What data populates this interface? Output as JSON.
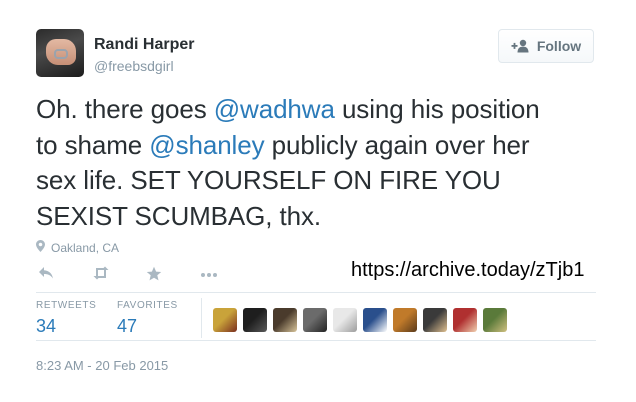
{
  "author": {
    "name": "Randi Harper",
    "handle": "@freebsdgirl"
  },
  "follow_button": {
    "label": "Follow"
  },
  "tweet": {
    "lines": [
      [
        {
          "text": "Oh. there goes ",
          "type": "text"
        },
        {
          "text": "@wadhwa",
          "type": "mention"
        },
        {
          "text": " using his position",
          "type": "text"
        }
      ],
      [
        {
          "text": "to shame ",
          "type": "text"
        },
        {
          "text": "@shanley",
          "type": "mention"
        },
        {
          "text": " publicly again over her",
          "type": "text"
        }
      ],
      [
        {
          "text": "sex life. SET YOURSELF ON FIRE YOU",
          "type": "text"
        }
      ],
      [
        {
          "text": "SEXIST SCUMBAG, thx.",
          "type": "text"
        }
      ]
    ]
  },
  "location": "Oakland, CA",
  "actions": [
    {
      "name": "reply-icon"
    },
    {
      "name": "retweet-icon"
    },
    {
      "name": "favorite-star-icon"
    },
    {
      "name": "more-options-icon"
    }
  ],
  "archive_link": "https://archive.today/zTjb1",
  "stats": {
    "retweets_label": "RETWEETS",
    "retweets_count": "34",
    "favorites_label": "FAVORITES",
    "favorites_count": "47"
  },
  "favoriter_avatars": [
    {
      "name": "favoriter-avatar-1",
      "colors": [
        "#c9a33a",
        "#7a2e1e"
      ]
    },
    {
      "name": "favoriter-avatar-2",
      "colors": [
        "#1e1e1e",
        "#5a5a5a"
      ]
    },
    {
      "name": "favoriter-avatar-3",
      "colors": [
        "#4a3b2c",
        "#d8c49a"
      ]
    },
    {
      "name": "favoriter-avatar-4",
      "colors": [
        "#6b6b6b",
        "#222222"
      ]
    },
    {
      "name": "favoriter-avatar-5",
      "colors": [
        "#e8e8e8",
        "#9c9c9c"
      ]
    },
    {
      "name": "favoriter-avatar-6",
      "colors": [
        "#2a4f8c",
        "#ffffff"
      ]
    },
    {
      "name": "favoriter-avatar-7",
      "colors": [
        "#c07a2a",
        "#5a3a1a"
      ]
    },
    {
      "name": "favoriter-avatar-8",
      "colors": [
        "#3a3a3a",
        "#e0c090"
      ]
    },
    {
      "name": "favoriter-avatar-9",
      "colors": [
        "#b03030",
        "#f0d0b0"
      ]
    },
    {
      "name": "favoriter-avatar-10",
      "colors": [
        "#5a7a3a",
        "#d0c080"
      ]
    }
  ],
  "timestamp": "8:23 AM - 20 Feb 2015",
  "colors": {
    "link": "#2b7bb9",
    "text": "#292f33",
    "muted": "#8899a6",
    "border": "#e1e8ed"
  }
}
